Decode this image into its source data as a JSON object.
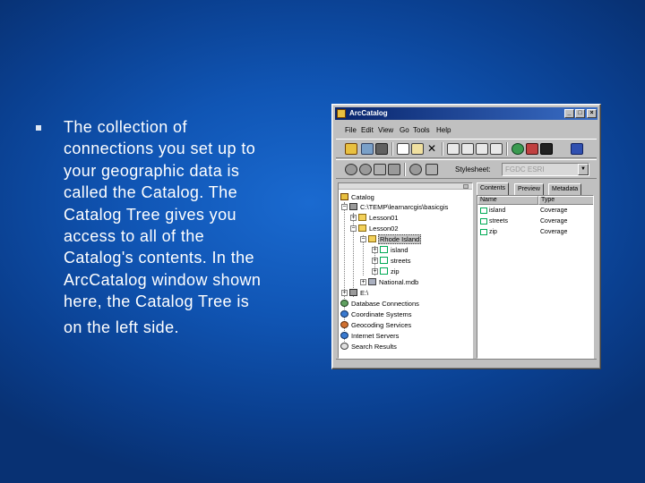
{
  "slide": {
    "bullet_marker": "n",
    "text_lines": [
      "The collection of",
      "connections you set up to",
      "your geographic data is",
      "called the Catalog. The",
      "Catalog Tree gives you",
      "access to all of the",
      "Catalog's contents. In the",
      "ArcCatalog window shown",
      "here, the Catalog Tree is"
    ],
    "tail_line": "on the left side."
  },
  "window": {
    "title": "ArcCatalog",
    "controls": {
      "minimize": "_",
      "maximize": "□",
      "close": "×"
    },
    "menu": [
      "File",
      "Edit",
      "View",
      "Go",
      "Tools",
      "Help"
    ],
    "stylesheet_label": "Stylesheet:",
    "stylesheet_value": "FGDC ESRI",
    "tabs": [
      "Contents",
      "Preview",
      "Metadata"
    ],
    "columns": [
      "Name",
      "Type"
    ],
    "rows": [
      {
        "name": "island",
        "type": "Coverage"
      },
      {
        "name": "streets",
        "type": "Coverage"
      },
      {
        "name": "zip",
        "type": "Coverage"
      }
    ],
    "tree": {
      "root": "Catalog",
      "path": "C:\\TEMP\\learnarcgis\\basicgis",
      "lesson01": "Lesson01",
      "lesson02": "Lesson02",
      "rhode_island": "Rhode Island",
      "island": "island",
      "streets": "streets",
      "zip": "zip",
      "national": "National.mdb",
      "drive_e": "E:\\",
      "database_connections": "Database Connections",
      "coordinate_systems": "Coordinate Systems",
      "geocoding_services": "Geocoding Services",
      "internet_servers": "Internet Servers",
      "search_results": "Search Results"
    }
  },
  "colors": {
    "background": "#1055b4",
    "titlebar": "#08246b",
    "window_face": "#c0c0c0"
  }
}
